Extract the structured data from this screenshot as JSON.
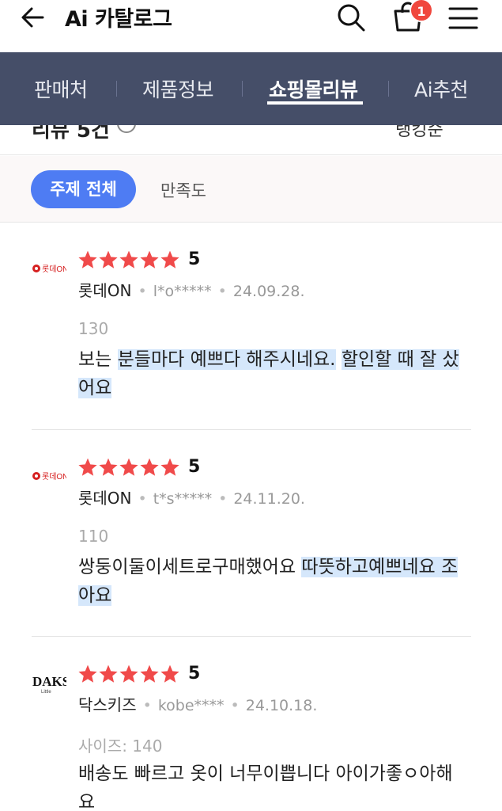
{
  "header": {
    "title": "Ai 카탈로그",
    "cart_count": "1"
  },
  "tabs": [
    {
      "label": "판매처",
      "active": false
    },
    {
      "label": "제품정보",
      "active": false
    },
    {
      "label": "쇼핑몰리뷰",
      "active": true
    },
    {
      "label": "Ai추천",
      "active": false
    }
  ],
  "summary": {
    "left_peek": "리뷰 5건",
    "right_peek": "랭킹순"
  },
  "filters": {
    "all_topics": "주제 전체",
    "satisfaction": "만족도"
  },
  "colors": {
    "tab_bg": "#454e68",
    "chip_bg": "#4e7cf3",
    "star": "#f04a4a",
    "badge": "#f0473d",
    "highlight": "#d5e7fb"
  },
  "reviews": [
    {
      "logo": "lotte-on-logo",
      "rating": 5,
      "score": "5",
      "store": "롯데ON",
      "user": "l*o*****",
      "date": "24.09.28.",
      "option": "130",
      "segments": [
        {
          "text": "보는 ",
          "hl": false
        },
        {
          "text": "분들마다 예쁘다 해주시네요.",
          "hl": true
        },
        {
          "text": " ",
          "hl": false
        },
        {
          "text": "할인할 때 잘 샀어요",
          "hl": true
        }
      ]
    },
    {
      "logo": "lotte-on-logo",
      "rating": 5,
      "score": "5",
      "store": "롯데ON",
      "user": "t*s*****",
      "date": "24.11.20.",
      "option": "110",
      "segments": [
        {
          "text": "쌍둥이둘이세트로구매했어요 ",
          "hl": false
        },
        {
          "text": "따뜻하고예쁘네요 조아요",
          "hl": true
        }
      ]
    },
    {
      "logo": "daks-little-logo",
      "rating": 5,
      "score": "5",
      "store": "닥스키즈",
      "user": "kobe****",
      "date": "24.10.18.",
      "option": "사이즈: 140",
      "segments": [
        {
          "text": "배송도 빠르고 옷이 너무이쁩니다 아이가좋ㅇ아해요",
          "hl": false
        }
      ]
    }
  ]
}
